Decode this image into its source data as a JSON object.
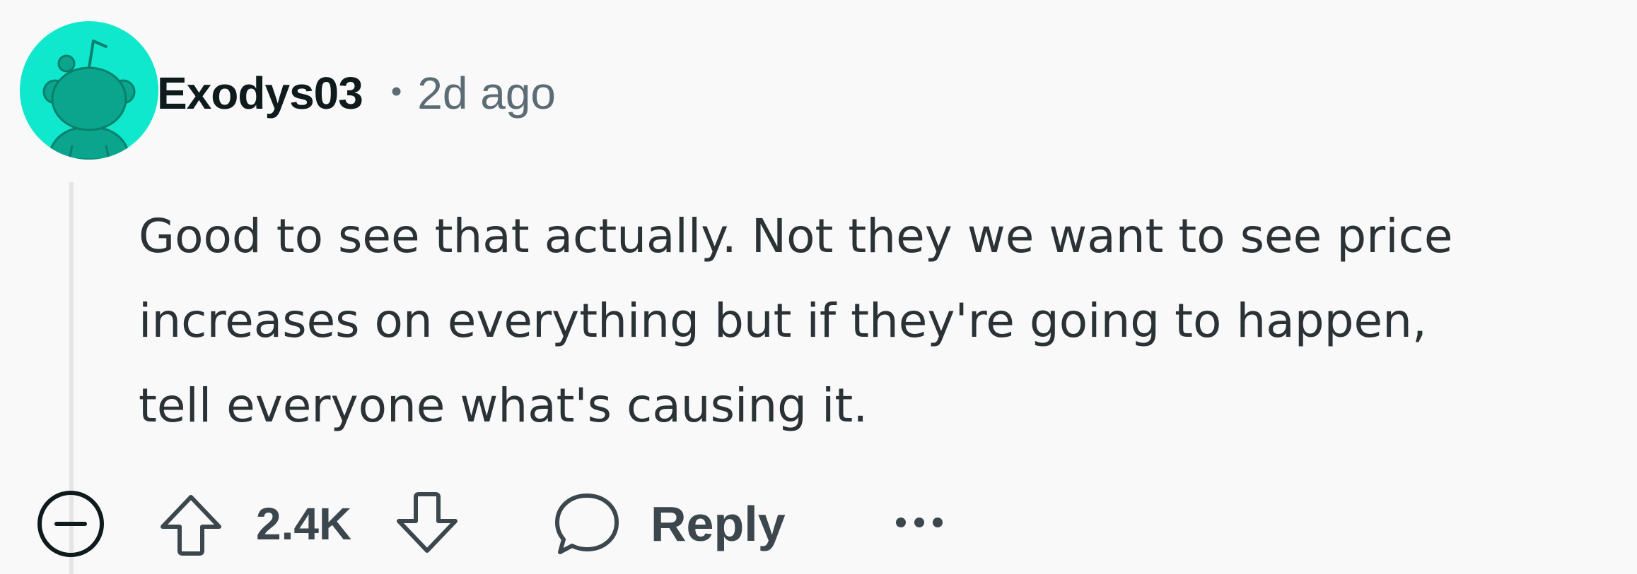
{
  "comment": {
    "author": "Exodys03",
    "separator": "•",
    "time_ago": "2d ago",
    "body_lines": [
      "Good to see that actually. Not they we want to see price",
      "increases on everything but if they're going to happen,",
      "tell everyone what's causing it."
    ],
    "avatar_icon": "snoo-avatar-icon",
    "avatar_background": "#0fe8cc"
  },
  "actions": {
    "collapse_icon": "collapse-minus-icon",
    "upvote_icon": "upvote-arrow-icon",
    "score": "2.4K",
    "downvote_icon": "downvote-arrow-icon",
    "reply_icon": "speech-bubble-icon",
    "reply_label": "Reply",
    "more_icon": "ellipsis-icon"
  }
}
